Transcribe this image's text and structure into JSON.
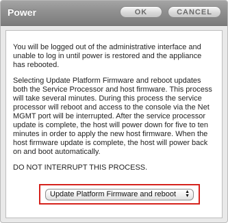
{
  "dialog": {
    "title": "Power",
    "ok_label": "OK",
    "cancel_label": "CANCEL"
  },
  "content": {
    "paragraph1": "You will be logged out of the administrative interface and unable to log in until power is restored and the appliance has rebooted.",
    "paragraph2": "Selecting Update Platform Firmware and reboot updates both the Service Processor and host firmware. This process will take several minutes. During this process the service processor will reboot and access to the console via the Net MGMT port will be interrupted. After the service processor update is complete, the host will power down for five to ten minutes in order to apply the new host firmware. When the host firmware update is complete, the host will power back on and boot automatically.",
    "paragraph3": "DO NOT INTERRUPT THIS PROCESS."
  },
  "select": {
    "value": "Update Platform Firmware and reboot",
    "arrows_icon": "updown-arrows-icon"
  },
  "colors": {
    "highlight": "#d5211b"
  }
}
